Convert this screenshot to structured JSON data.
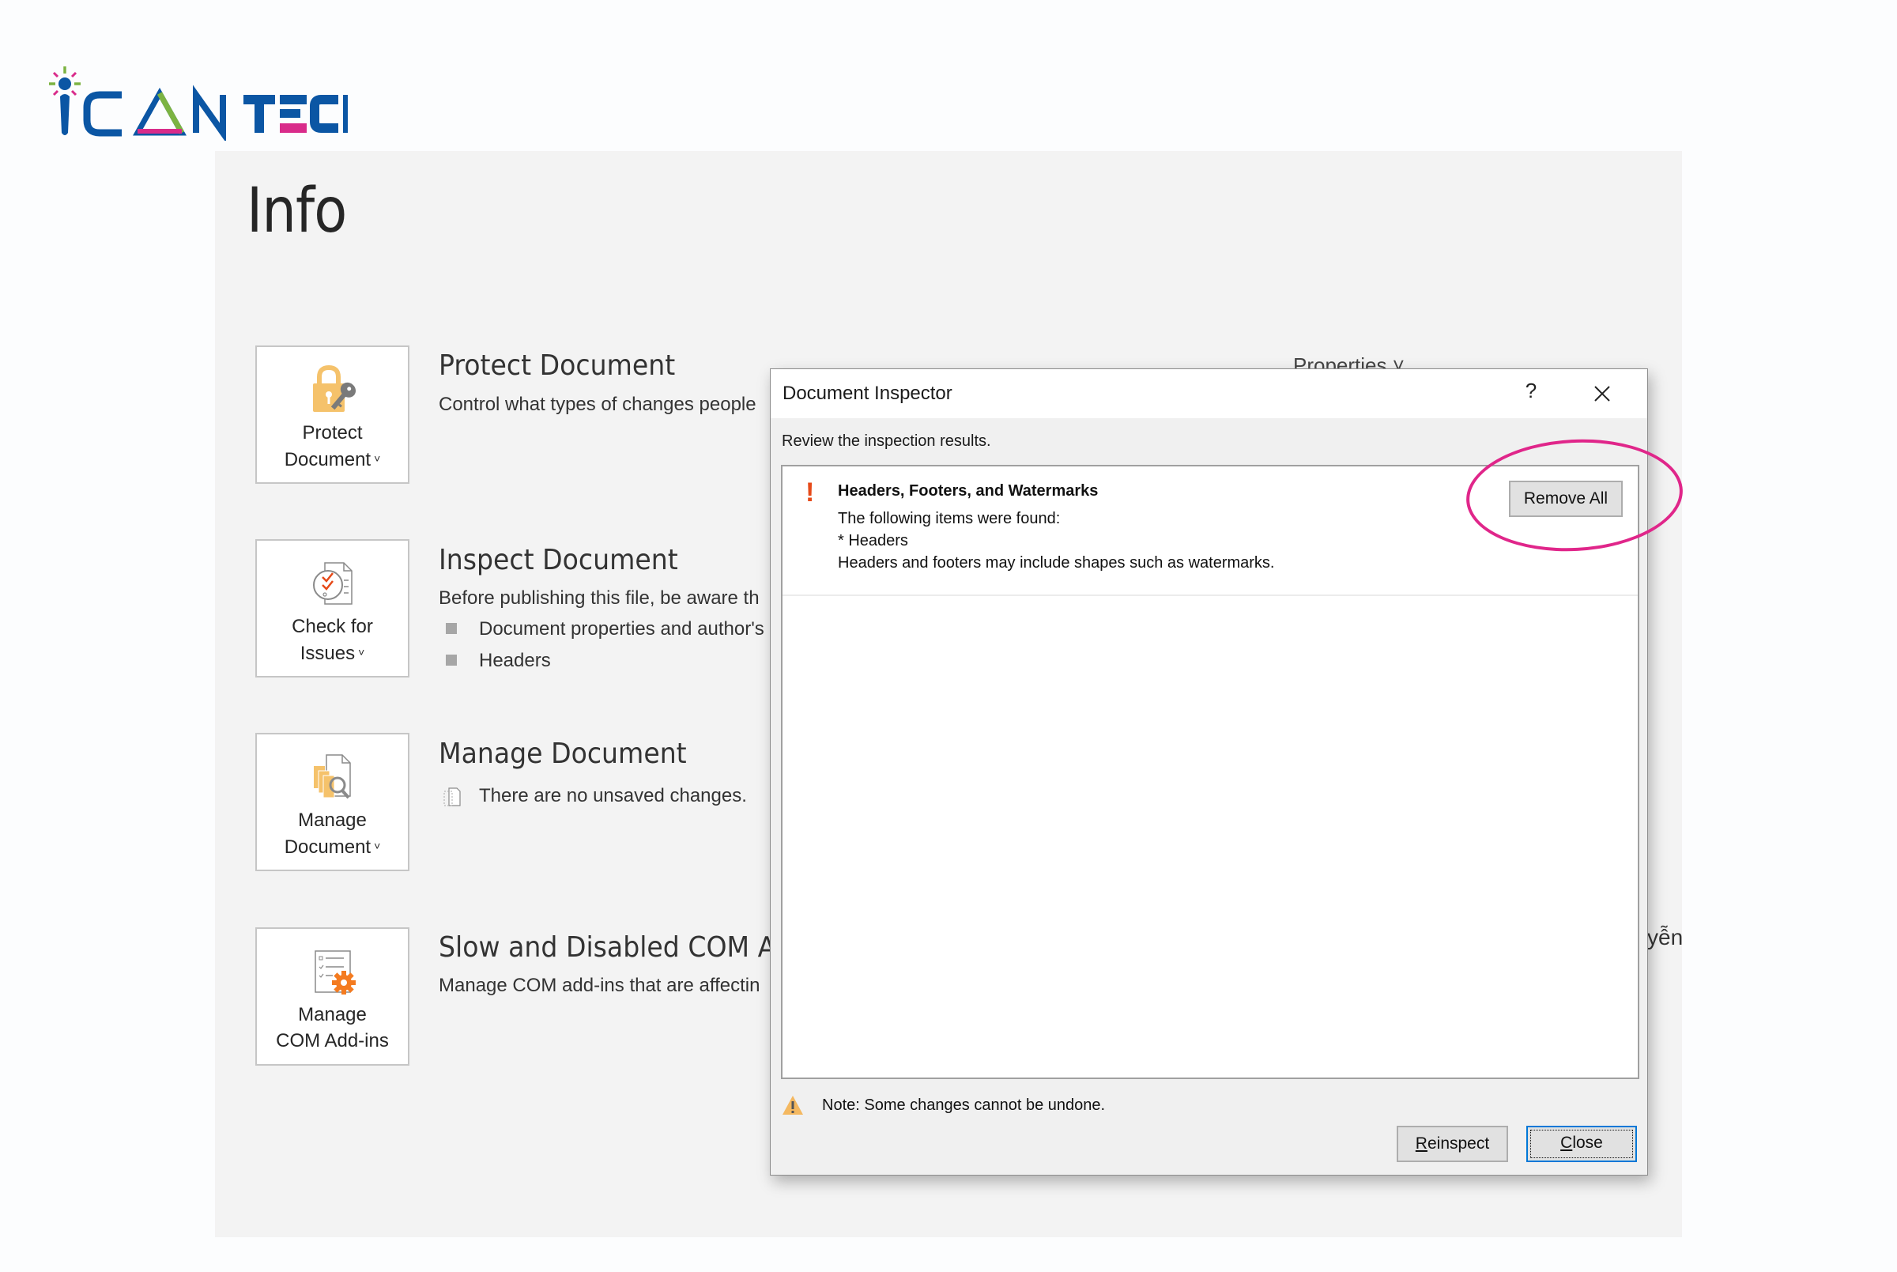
{
  "logo": {
    "text_i_can": "CAN",
    "text_tech": "TECH",
    "colors": {
      "blue": "#0b56a4",
      "pink": "#d92b8a",
      "green": "#7cb342"
    }
  },
  "backstage": {
    "title": "Info",
    "properties_label": "Properties ˅",
    "cutoff_text": "yễn",
    "sections": [
      {
        "tile_label_line1": "Protect",
        "tile_label_line2": "Document",
        "tile_icon": "lock-key-icon",
        "has_dropdown": true,
        "title": "Protect Document",
        "description": "Control what types of changes people"
      },
      {
        "tile_label_line1": "Check for",
        "tile_label_line2": "Issues",
        "tile_icon": "checklist-document-icon",
        "has_dropdown": true,
        "title": "Inspect Document",
        "description": "Before publishing this file, be aware th",
        "bullets": [
          "Document properties and author's",
          "Headers"
        ]
      },
      {
        "tile_label_line1": "Manage",
        "tile_label_line2": "Document",
        "tile_icon": "manage-document-search-icon",
        "has_dropdown": true,
        "title": "Manage Document",
        "description": "There are no unsaved changes.",
        "description_icon": "unsaved-document-icon"
      },
      {
        "tile_label_line1": "Manage",
        "tile_label_line2": "COM Add-ins",
        "tile_icon": "addins-gear-icon",
        "has_dropdown": false,
        "title": "Slow and Disabled COM A",
        "description": "Manage COM add-ins that are affectin"
      }
    ],
    "dropdown_glyph": "˅"
  },
  "dialog": {
    "title": "Document Inspector",
    "help_label": "?",
    "subtitle": "Review the inspection results.",
    "results": [
      {
        "status_icon": "warning-exclamation-icon",
        "status_glyph": "!",
        "heading": "Headers, Footers, and Watermarks",
        "lines": [
          "The following items were found:",
          "* Headers",
          "Headers and footers may include shapes such as watermarks."
        ],
        "action_label": "Remove All"
      }
    ],
    "note": "Note: Some changes cannot be undone.",
    "buttons": {
      "reinspect_mnemonic": "R",
      "reinspect_rest": "einspect",
      "close_mnemonic": "C",
      "close_rest": "lose"
    },
    "colors": {
      "accent_focus": "#0078d7",
      "highlight_ring": "#e0268a",
      "exclamation": "#e64a19",
      "warning": "#f4b860"
    }
  }
}
